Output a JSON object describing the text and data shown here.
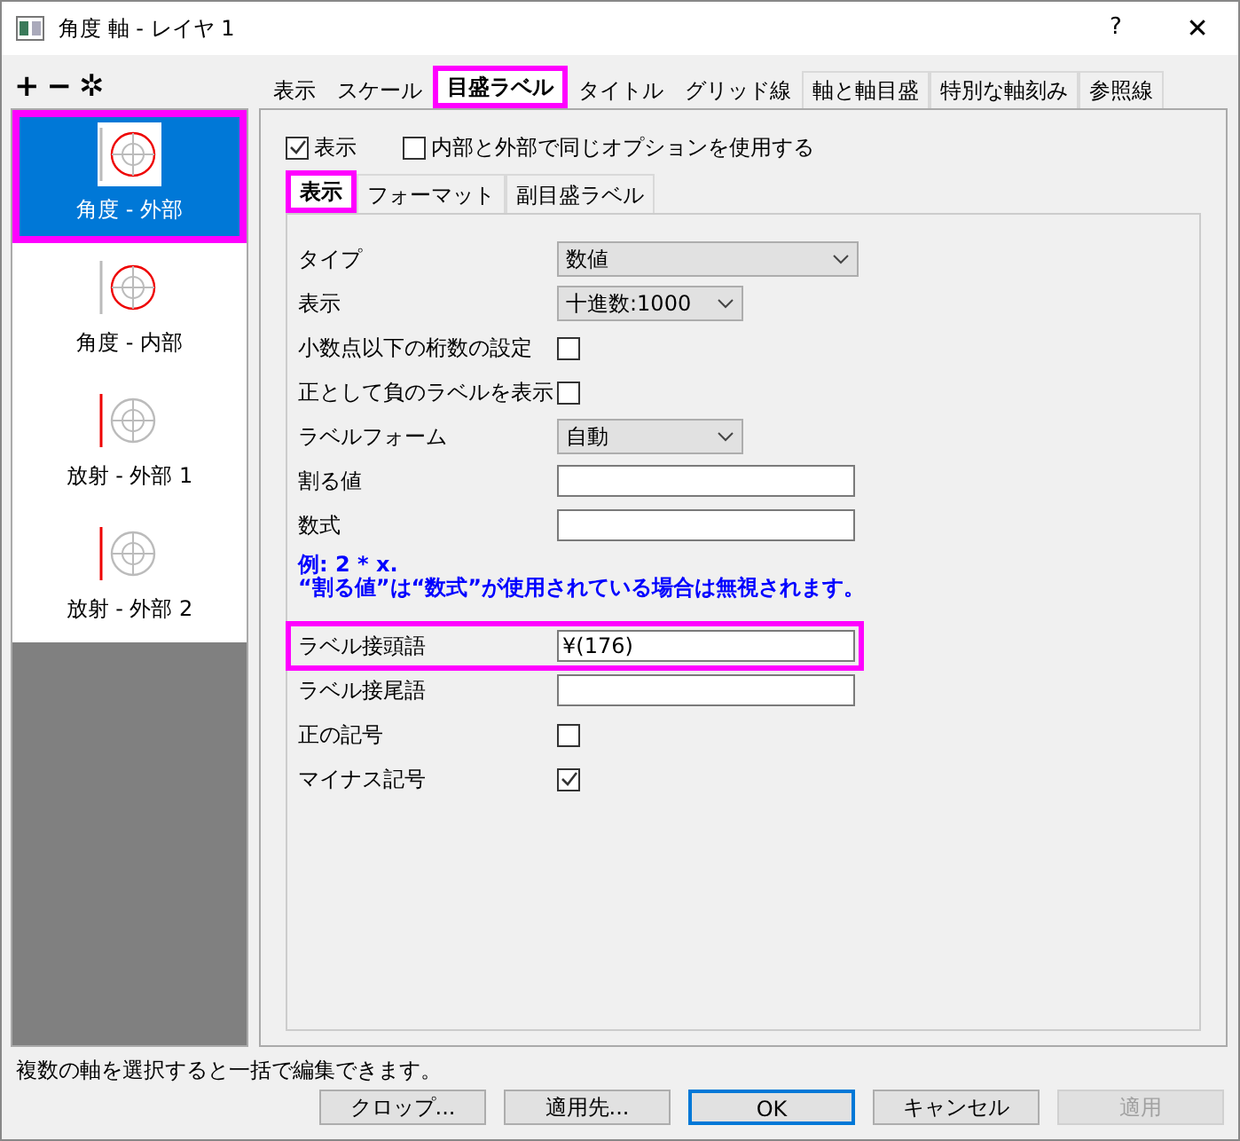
{
  "window": {
    "title": "角度 軸 - レイヤ 1",
    "help": "?",
    "close": "✕"
  },
  "toolbar": [
    {
      "label": "+"
    },
    {
      "label": "−"
    },
    {
      "label": "✲"
    }
  ],
  "axes": [
    {
      "kind": "angle",
      "label": "角度 - 外部",
      "selected": true,
      "highlight": true
    },
    {
      "kind": "angle",
      "label": "角度 - 内部",
      "selected": false,
      "highlight": false
    },
    {
      "kind": "radial",
      "label": "放射 - 外部 1",
      "selected": false,
      "highlight": false
    },
    {
      "kind": "radial",
      "label": "放射 - 外部 2",
      "selected": false,
      "highlight": false
    }
  ],
  "tabs": [
    {
      "label": "表示",
      "selected": false,
      "highlight": false
    },
    {
      "label": "スケール",
      "selected": false,
      "highlight": false
    },
    {
      "label": "目盛ラベル",
      "selected": true,
      "highlight": true
    },
    {
      "label": "タイトル",
      "selected": false,
      "highlight": false
    },
    {
      "label": "グリッド線",
      "selected": false,
      "highlight": false
    },
    {
      "label": "軸と軸目盛",
      "selected": false,
      "highlight": false
    },
    {
      "label": "特別な軸刻み",
      "selected": false,
      "highlight": false
    },
    {
      "label": "参照線",
      "selected": false,
      "highlight": false
    }
  ],
  "options": [
    {
      "label": "表示",
      "checked": true
    },
    {
      "label": "内部と外部で同じオプションを使用する",
      "checked": false
    }
  ],
  "subtabs": [
    {
      "label": "表示",
      "selected": true,
      "highlight": true
    },
    {
      "label": "フォーマット",
      "selected": false,
      "highlight": false
    },
    {
      "label": "副目盛ラベル",
      "selected": false,
      "highlight": false
    }
  ],
  "fields": [
    {
      "kind": "combobox",
      "label": "タイプ",
      "value": "数値"
    },
    {
      "kind": "select",
      "label": "表示",
      "value": "十進数:1000"
    },
    {
      "kind": "checkbox",
      "label": "小数点以下の桁数の設定",
      "checked": false
    },
    {
      "kind": "checkbox",
      "label": "正として負のラベルを表示",
      "checked": false
    },
    {
      "kind": "select",
      "label": "ラベルフォーム",
      "value": "自動"
    },
    {
      "kind": "input",
      "label": "割る値"
    },
    {
      "kind": "input",
      "label": "数式"
    },
    {
      "kind": "note",
      "lines": [
        "例: 2 * x.",
        "“割る値”は“数式”が使用されている場合は無視されます。"
      ]
    },
    {
      "kind": "input",
      "label": "ラベル接頭語",
      "value": "¥(176)",
      "highlight": true
    },
    {
      "kind": "input",
      "label": "ラベル接尾語"
    },
    {
      "kind": "checkbox",
      "label": "正の記号",
      "checked": false
    },
    {
      "kind": "checkbox",
      "label": "マイナス記号",
      "checked": true
    }
  ],
  "status_bar": "複数の軸を選択すると一括で編集できます。",
  "buttons": [
    {
      "label": "クロップ...",
      "default": false,
      "disabled": false
    },
    {
      "label": "適用先...",
      "default": false,
      "disabled": false
    },
    {
      "label": "OK",
      "default": true,
      "disabled": false
    },
    {
      "label": "キャンセル",
      "default": false,
      "disabled": false
    },
    {
      "label": "適用",
      "default": false,
      "disabled": true
    }
  ]
}
